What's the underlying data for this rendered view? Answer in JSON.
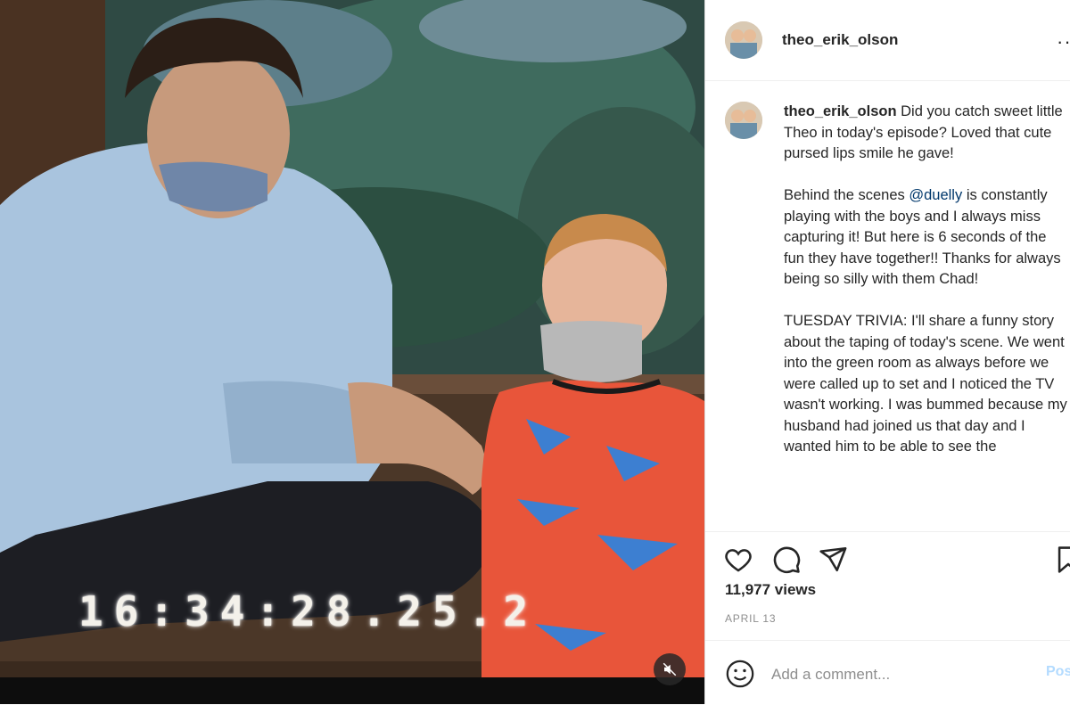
{
  "video": {
    "timecode": "16:34:28.25.2"
  },
  "post": {
    "username": "theo_erik_olson",
    "more_icon": "more-horizontal-icon",
    "caption": {
      "user": "theo_erik_olson",
      "text_1": " Did you catch sweet little Theo in today's episode? Loved that cute pursed lips smile he gave!\n\nBehind the scenes ",
      "mention": "@duelly",
      "text_2": " is constantly playing with the boys and I always miss capturing it! But here is 6 seconds of the fun they have together!! Thanks for always being so silly with them Chad!\n\nTUESDAY TRIVIA: I'll share a funny story about the taping of today's scene. We went into the green room as always before we were called up to set and I noticed the TV wasn't working. I was bummed because my husband had joined us that day and I wanted him to be able to see the"
    },
    "views": "11,977 views",
    "date": "APRIL 13",
    "comment_placeholder": "Add a comment...",
    "post_label": "Post"
  },
  "icons": [
    "heart-icon",
    "comment-icon",
    "share-icon",
    "bookmark-icon",
    "emoji-icon",
    "mute-icon"
  ]
}
